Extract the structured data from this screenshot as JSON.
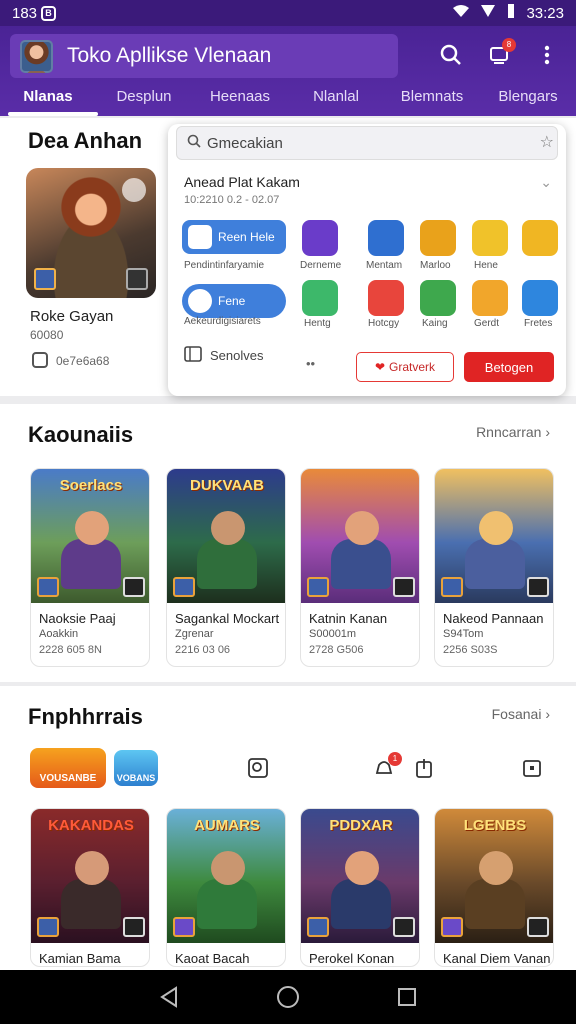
{
  "status": {
    "time_left": "183",
    "time_right": "33:23",
    "badge": "B"
  },
  "app": {
    "title": "Toko Apllikse Vlenaan"
  },
  "tabs": [
    "Nlanas",
    "Desplun",
    "Heenaas",
    "Nlanlal",
    "Blemnats",
    "Blengars"
  ],
  "featured": {
    "title": "Dea Anhan",
    "name": "Roke Gayan",
    "meta": "60080",
    "size": "0e7e6a68"
  },
  "popup": {
    "search_value": "Gmecakian",
    "title": "Anead Plat Kakam",
    "date": "10:2210 0.2 - 02.07",
    "pill1": "Reen Hele",
    "pill1_label": "Pendintinfaryamie",
    "pill2": "Fene",
    "pill2_label": "Aekeurdigisiarets",
    "row1_labels": [
      "Derneme",
      "Mentam",
      "Marloo",
      "Hene"
    ],
    "row2_labels": [
      "Hentg",
      "Hotcgy",
      "Kaing",
      "Gerdt",
      "Fretes"
    ],
    "footer_label": "Senolves",
    "dots": "••",
    "btn_outline": "Gratverk",
    "btn_solid": "Betogen"
  },
  "section2": {
    "title": "Kaounaiis",
    "more": "Rnncarran",
    "cards": [
      {
        "logo": "Soerlacs",
        "name": "Naoksie Paaj",
        "sub": "Aoakkin",
        "size": "2228 605 8N"
      },
      {
        "logo": "DUKVAAB",
        "name": "Sagankal Mockart",
        "sub": "Zgrenar",
        "size": "2216 03 06"
      },
      {
        "logo": "",
        "name": "Katnin Kanan",
        "sub": "S00001m",
        "size": "2728 G506"
      },
      {
        "logo": "",
        "name": "Nakeod Pannaan",
        "sub": "S94Tom",
        "size": "2256 S03S"
      }
    ]
  },
  "section3": {
    "title": "Fnphhrrais",
    "more": "Fosanai",
    "logo_a": "VOUSANBE",
    "logo_b": "VOBANS",
    "notif_count": "1",
    "cards": [
      {
        "logo": "KAKANDAS",
        "name": "Kamian Bama"
      },
      {
        "logo": "AUMARS",
        "name": "Kaoat Bacah"
      },
      {
        "logo": "PDDXAR",
        "name": "Perokel Konan"
      },
      {
        "logo": "LGENBS",
        "name": "Kanal Diem Vanan"
      }
    ]
  },
  "colors": {
    "primary": "#5a2da8",
    "accent": "#e02424"
  }
}
